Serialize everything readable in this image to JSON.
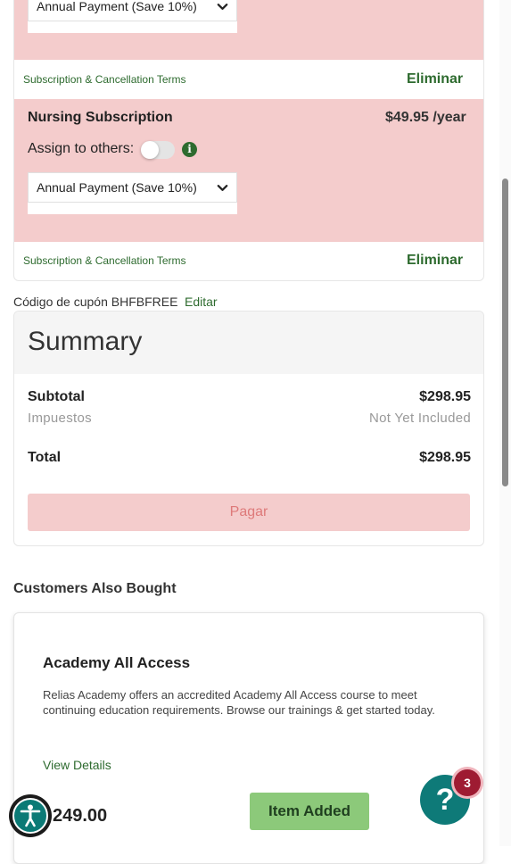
{
  "cart": {
    "items": [
      {
        "name": "",
        "payment_option": "Annual Payment (Save 10%)",
        "terms_link": "Subscription & Cancellation Terms",
        "remove_label": "Eliminar"
      },
      {
        "name": "Nursing Subscription",
        "price": "$49.95 /year",
        "assign_label": "Assign to others:",
        "assign_enabled": false,
        "payment_option": "Annual Payment (Save 10%)",
        "terms_link": "Subscription & Cancellation Terms",
        "remove_label": "Eliminar"
      }
    ]
  },
  "coupon": {
    "label": "Código de cupón BHFBFREE",
    "edit_label": "Editar"
  },
  "summary": {
    "title": "Summary",
    "subtotal_label": "Subtotal",
    "subtotal_value": "$298.95",
    "tax_label": "Impuestos",
    "tax_value": "Not Yet Included",
    "total_label": "Total",
    "total_value": "$298.95",
    "pay_label": "Pagar"
  },
  "also_bought": {
    "title": "Customers Also Bought",
    "product": {
      "name": "Academy All Access",
      "description": "Relias Academy offers an accredited Academy All Access course to meet continuing education requirements. Browse our trainings & get started today.",
      "details_link": "View Details",
      "price": "249.00",
      "button_label": "Item Added"
    }
  },
  "help": {
    "icon_glyph": "?",
    "badge_count": "3"
  },
  "colors": {
    "accent_green": "#2e6b2f",
    "pink_highlight": "#f4cccc",
    "teal": "#0e7a78",
    "badge_red": "#9e1b32"
  }
}
